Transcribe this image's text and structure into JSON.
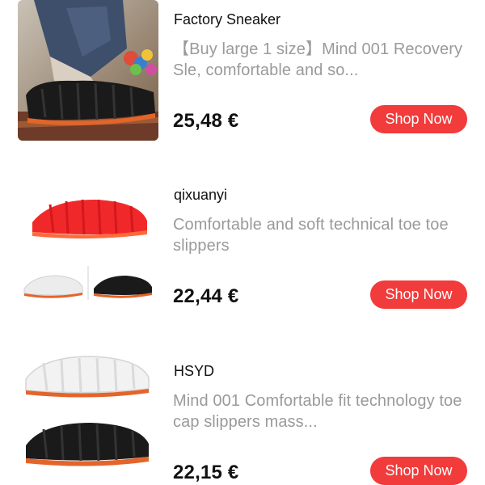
{
  "products": [
    {
      "shop": "Factory Sneaker",
      "title": "【Buy large 1 size】Mind 001 Recovery Sle, comfortable and so...",
      "price": "25,48 €",
      "button": "Shop Now"
    },
    {
      "shop": "qixuanyi",
      "title": "Comfortable and soft technical toe toe slippers",
      "price": "22,44 €",
      "button": "Shop Now"
    },
    {
      "shop": "HSYD",
      "title": "Mind 001 Comfortable fit technology toe cap slippers mass...",
      "price": "22,15 €",
      "button": "Shop Now"
    }
  ],
  "colors": {
    "accent": "#f23b3b",
    "muted_text": "#9a9a9a",
    "slipper_red": "#f0282a",
    "slipper_black": "#1a1a1a",
    "sole_orange": "#e4642a"
  },
  "icons": [
    "product-thumbnail"
  ]
}
